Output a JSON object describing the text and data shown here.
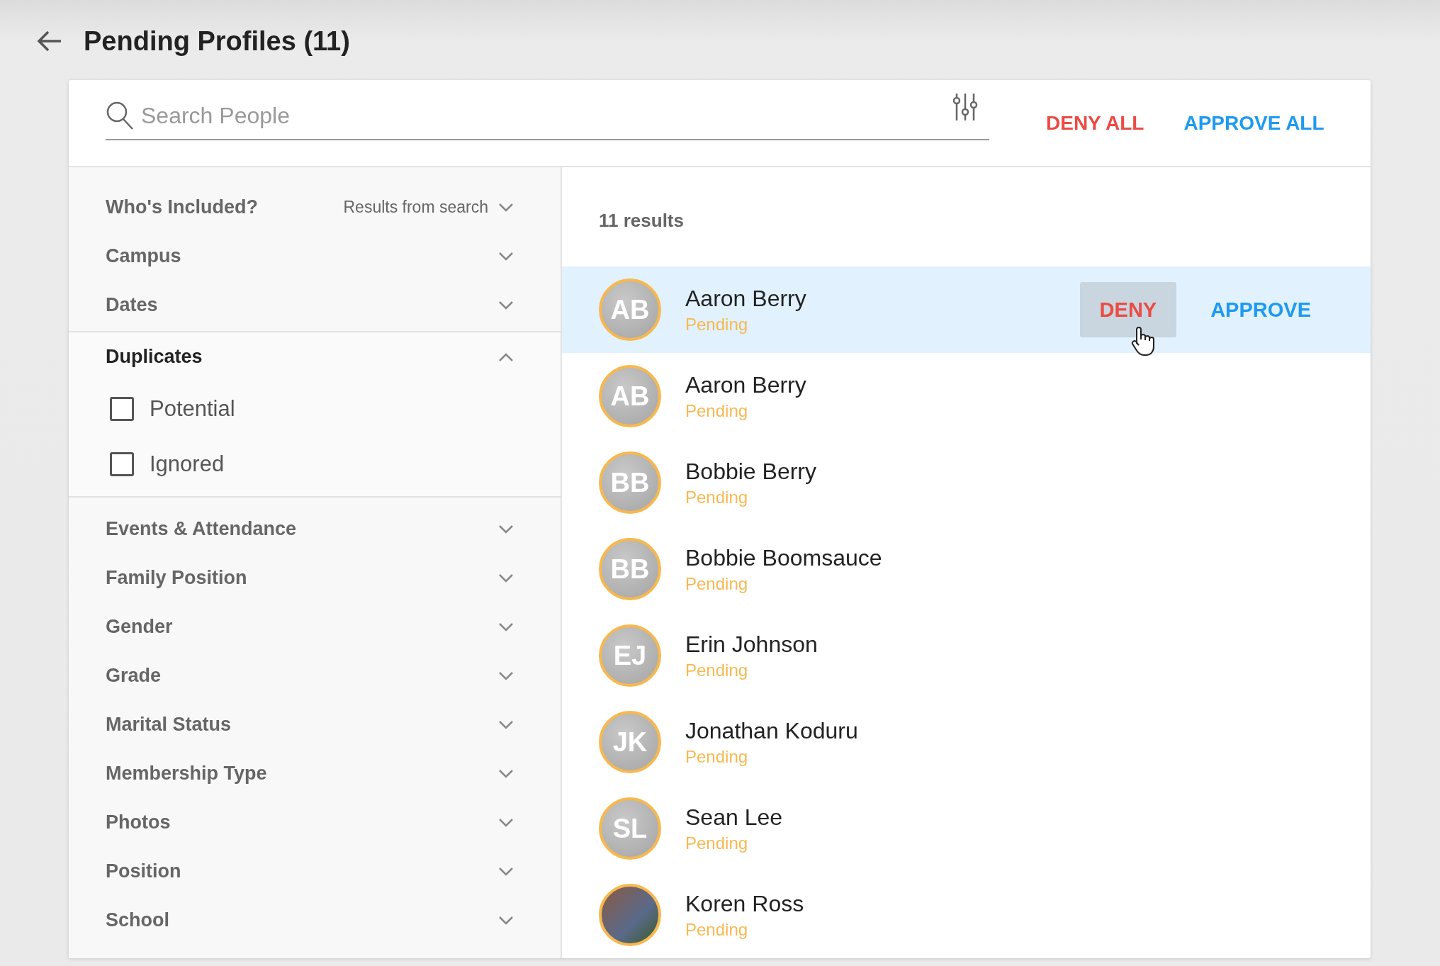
{
  "page": {
    "title": "Pending Profiles (11)"
  },
  "search": {
    "placeholder": "Search People"
  },
  "bulk_actions": [
    {
      "label": "DENY ALL",
      "kind": "deny"
    },
    {
      "label": "APPROVE ALL",
      "kind": "approve"
    }
  ],
  "filters": [
    {
      "kind": "dropdown",
      "label": "Who's Included?",
      "value": "Results from search",
      "expanded": false
    },
    {
      "kind": "dropdown",
      "label": "Campus",
      "expanded": false
    },
    {
      "kind": "dropdown",
      "label": "Dates",
      "expanded": false
    },
    {
      "kind": "group",
      "label": "Duplicates",
      "expanded": true,
      "options": [
        {
          "label": "Potential",
          "checked": false
        },
        {
          "label": "Ignored",
          "checked": false
        }
      ]
    },
    {
      "kind": "dropdown",
      "label": "Events & Attendance",
      "expanded": false
    },
    {
      "kind": "dropdown",
      "label": "Family Position",
      "expanded": false
    },
    {
      "kind": "dropdown",
      "label": "Gender",
      "expanded": false
    },
    {
      "kind": "dropdown",
      "label": "Grade",
      "expanded": false
    },
    {
      "kind": "dropdown",
      "label": "Marital Status",
      "expanded": false
    },
    {
      "kind": "dropdown",
      "label": "Membership Type",
      "expanded": false
    },
    {
      "kind": "dropdown",
      "label": "Photos",
      "expanded": false
    },
    {
      "kind": "dropdown",
      "label": "Position",
      "expanded": false
    },
    {
      "kind": "dropdown",
      "label": "School",
      "expanded": false
    }
  ],
  "results": {
    "count": "11 results",
    "row_actions": [
      {
        "label": "DENY",
        "kind": "deny",
        "hovered": true
      },
      {
        "label": "APPROVE",
        "kind": "approve",
        "hovered": false
      }
    ],
    "people": [
      {
        "name": "Aaron Berry",
        "status": "Pending",
        "has_photo": false,
        "initials": "AB",
        "selected": true
      },
      {
        "name": "Aaron Berry",
        "status": "Pending",
        "has_photo": false,
        "initials": "AB",
        "selected": false
      },
      {
        "name": "Bobbie Berry",
        "status": "Pending",
        "has_photo": false,
        "initials": "BB",
        "selected": false
      },
      {
        "name": "Bobbie Boomsauce",
        "status": "Pending",
        "has_photo": false,
        "initials": "BB",
        "selected": false
      },
      {
        "name": "Erin Johnson",
        "status": "Pending",
        "has_photo": false,
        "initials": "EJ",
        "selected": false
      },
      {
        "name": "Jonathan Koduru",
        "status": "Pending",
        "has_photo": false,
        "initials": "JK",
        "selected": false
      },
      {
        "name": "Sean Lee",
        "status": "Pending",
        "has_photo": false,
        "initials": "SL",
        "selected": false
      },
      {
        "name": "Koren Ross",
        "status": "Pending",
        "has_photo": true,
        "selected": false
      }
    ]
  }
}
